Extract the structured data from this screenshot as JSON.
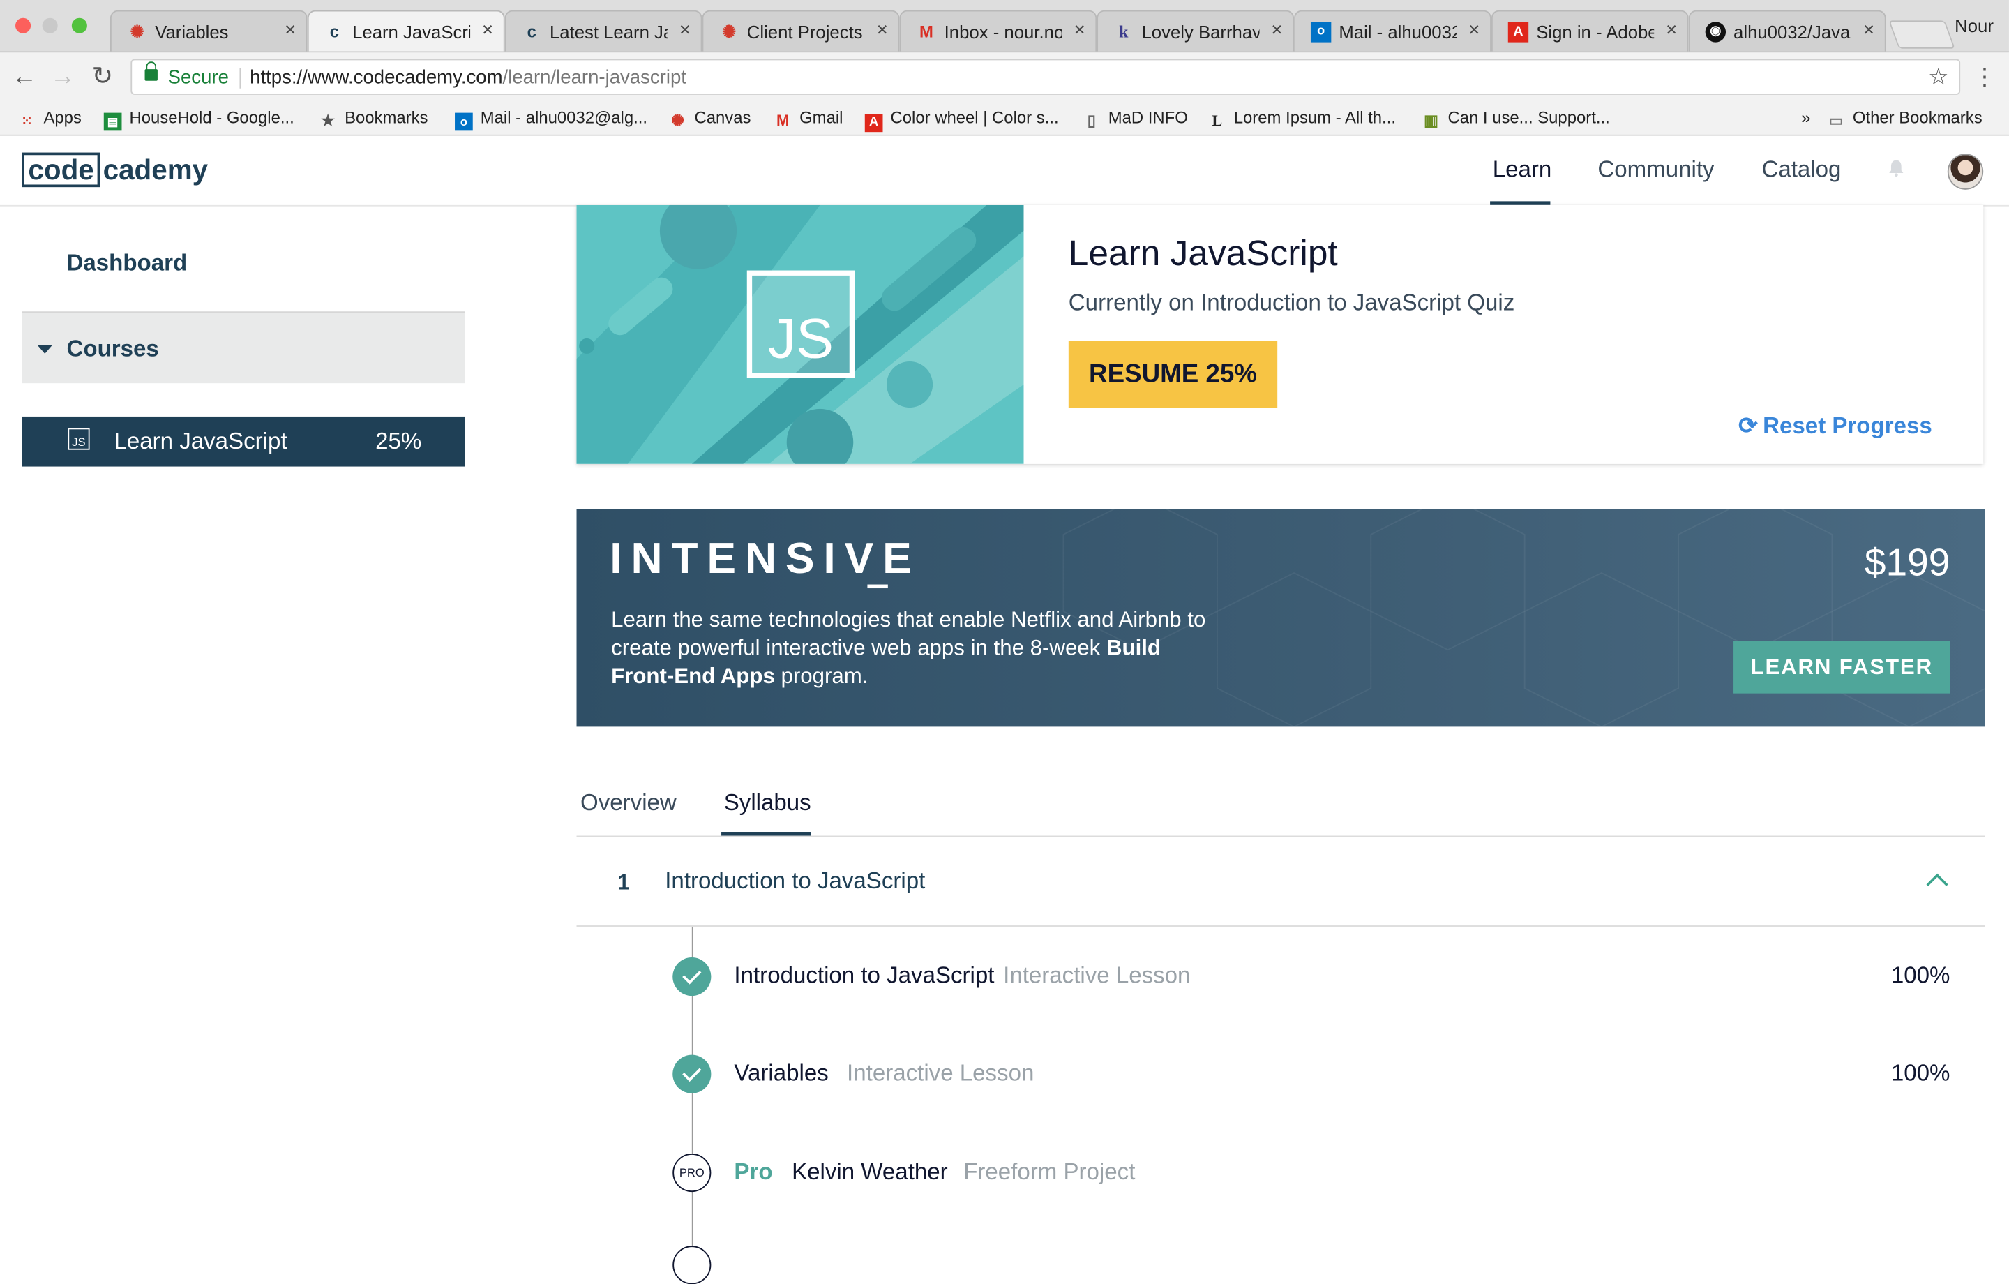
{
  "browser": {
    "tabs": [
      {
        "title": "Variables",
        "icon": "canvas-icon",
        "color": "#d33a2c"
      },
      {
        "title": "Learn JavaScrip",
        "icon": "codecademy-icon",
        "color": "#1f4056"
      },
      {
        "title": "Latest Learn Ja",
        "icon": "codecademy-icon",
        "color": "#1f4056"
      },
      {
        "title": "Client Projects",
        "icon": "canvas-icon",
        "color": "#d33a2c"
      },
      {
        "title": "Inbox - nour.no",
        "icon": "gmail-icon",
        "color": "#d93025"
      },
      {
        "title": "Lovely Barrhave",
        "icon": "k-icon",
        "color": "#3b3a8c"
      },
      {
        "title": "Mail - alhu0032",
        "icon": "outlook-icon",
        "color": "#0072c6"
      },
      {
        "title": "Sign in - Adobe",
        "icon": "adobe-icon",
        "color": "#e0271b"
      },
      {
        "title": "alhu0032/Java",
        "icon": "github-icon",
        "color": "#111111"
      }
    ],
    "profile_name": "Nour",
    "secure_label": "Secure",
    "url_host": "https://www.codecademy.com",
    "url_path": "/learn/learn-javascript",
    "bookmarks": [
      {
        "label": "Apps",
        "icon": "apps-grid-icon"
      },
      {
        "label": "HouseHold - Google...",
        "icon": "sheets-icon"
      },
      {
        "label": "Bookmarks",
        "icon": "star-icon"
      },
      {
        "label": "Mail - alhu0032@alg...",
        "icon": "outlook-icon"
      },
      {
        "label": "Canvas",
        "icon": "canvas-icon"
      },
      {
        "label": "Gmail",
        "icon": "gmail-icon"
      },
      {
        "label": "Color wheel | Color s...",
        "icon": "adobe-icon"
      },
      {
        "label": "MaD INFO",
        "icon": "document-icon"
      },
      {
        "label": "Lorem Ipsum - All th...",
        "icon": "lorem-icon"
      },
      {
        "label": "Can I use... Support...",
        "icon": "caniuse-icon"
      }
    ],
    "more_bookmarks": "»",
    "other_bookmarks": "Other Bookmarks"
  },
  "header": {
    "logo_box": "code",
    "logo_rest": "cademy",
    "nav": [
      "Learn",
      "Community",
      "Catalog"
    ]
  },
  "sidebar": {
    "dashboard": "Dashboard",
    "courses": "Courses",
    "course": {
      "icon_text": "JS",
      "name": "Learn JavaScript",
      "percent": "25%"
    }
  },
  "hero": {
    "icon_text": "JS",
    "title": "Learn JavaScript",
    "subtitle": "Currently on Introduction to JavaScript Quiz",
    "resume_label": "RESUME 25%",
    "reset_label": "Reset Progress"
  },
  "intensive": {
    "title": "INTENSIVE",
    "desc_pre": "Learn the same technologies that enable Netflix and Airbnb to create powerful interactive web apps in the 8-week ",
    "desc_bold": "Build Front-End Apps",
    "desc_post": " program.",
    "price": "$199",
    "cta": "LEARN FASTER"
  },
  "tabs": [
    "Overview",
    "Syllabus"
  ],
  "syllabus": {
    "unit_number": "1",
    "unit_title": "Introduction to JavaScript",
    "lessons": [
      {
        "name": "Introduction to JavaScript",
        "type": "Interactive Lesson",
        "percent": "100%"
      },
      {
        "name": "Variables",
        "type": "Interactive Lesson",
        "percent": "100%"
      },
      {
        "badge": "PRO",
        "pro_label": "Pro",
        "name": "Kelvin Weather",
        "type": "Freeform Project"
      }
    ]
  },
  "colors": {
    "brand": "#1f4056",
    "accent_yellow": "#f7c444",
    "teal": "#4fa69a",
    "link_blue": "#3a86d9"
  }
}
